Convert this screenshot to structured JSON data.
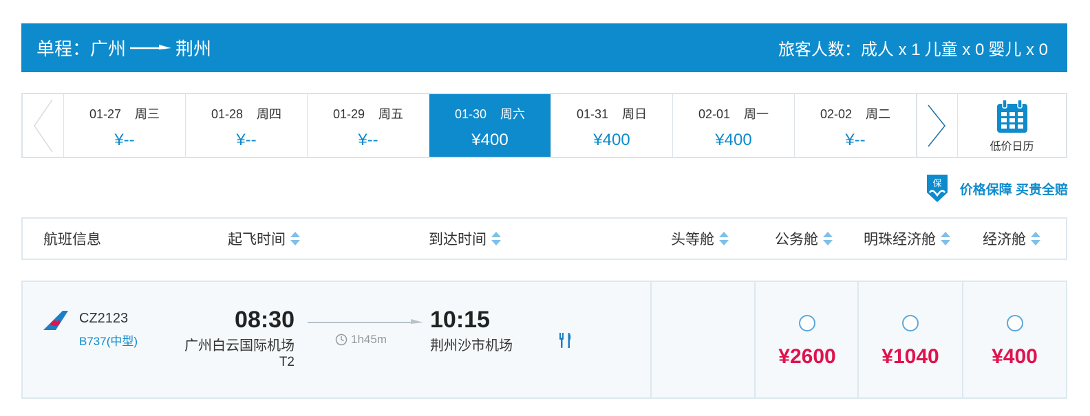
{
  "trip": {
    "prefix": "单程：",
    "from": "广州",
    "to": "荆州",
    "passengers": {
      "label": "旅客人数：",
      "adult": "成人 x 1",
      "child": "儿童 x 0",
      "infant": "婴儿 x 0"
    }
  },
  "dates": [
    {
      "date": "01-27",
      "weekday": "周三",
      "price": "¥--"
    },
    {
      "date": "01-28",
      "weekday": "周四",
      "price": "¥--"
    },
    {
      "date": "01-29",
      "weekday": "周五",
      "price": "¥--"
    },
    {
      "date": "01-30",
      "weekday": "周六",
      "price": "¥400",
      "selected": true
    },
    {
      "date": "01-31",
      "weekday": "周日",
      "price": "¥400"
    },
    {
      "date": "02-01",
      "weekday": "周一",
      "price": "¥400"
    },
    {
      "date": "02-02",
      "weekday": "周二",
      "price": "¥--"
    }
  ],
  "calendar": {
    "label": "低价日历",
    "icon": "calendar-icon"
  },
  "guarantee": {
    "text": "价格保障 买贵全赔",
    "icon": "shield-guarantee-icon",
    "badge": "保"
  },
  "columns": {
    "flight_info": "航班信息",
    "departure": "起飞时间",
    "arrival": "到达时间",
    "first": "头等舱",
    "business": "公务舱",
    "premium_economy": "明珠经济舱",
    "economy": "经济舱"
  },
  "flight": {
    "number": "CZ2123",
    "aircraft": "B737(中型)",
    "dep_time": "08:30",
    "dep_airport": "广州白云国际机场",
    "dep_terminal": "T2",
    "duration": "1h45m",
    "arr_time": "10:15",
    "arr_airport": "荆州沙市机场",
    "meal_icon": "meal-icon",
    "fares": {
      "business": "¥2600",
      "premium_economy": "¥1040",
      "economy": "¥400"
    }
  },
  "colors": {
    "brand": "#0e8bcc",
    "fare": "#e0134e",
    "border": "#dde3e8",
    "row_bg": "#f5f9fc"
  }
}
